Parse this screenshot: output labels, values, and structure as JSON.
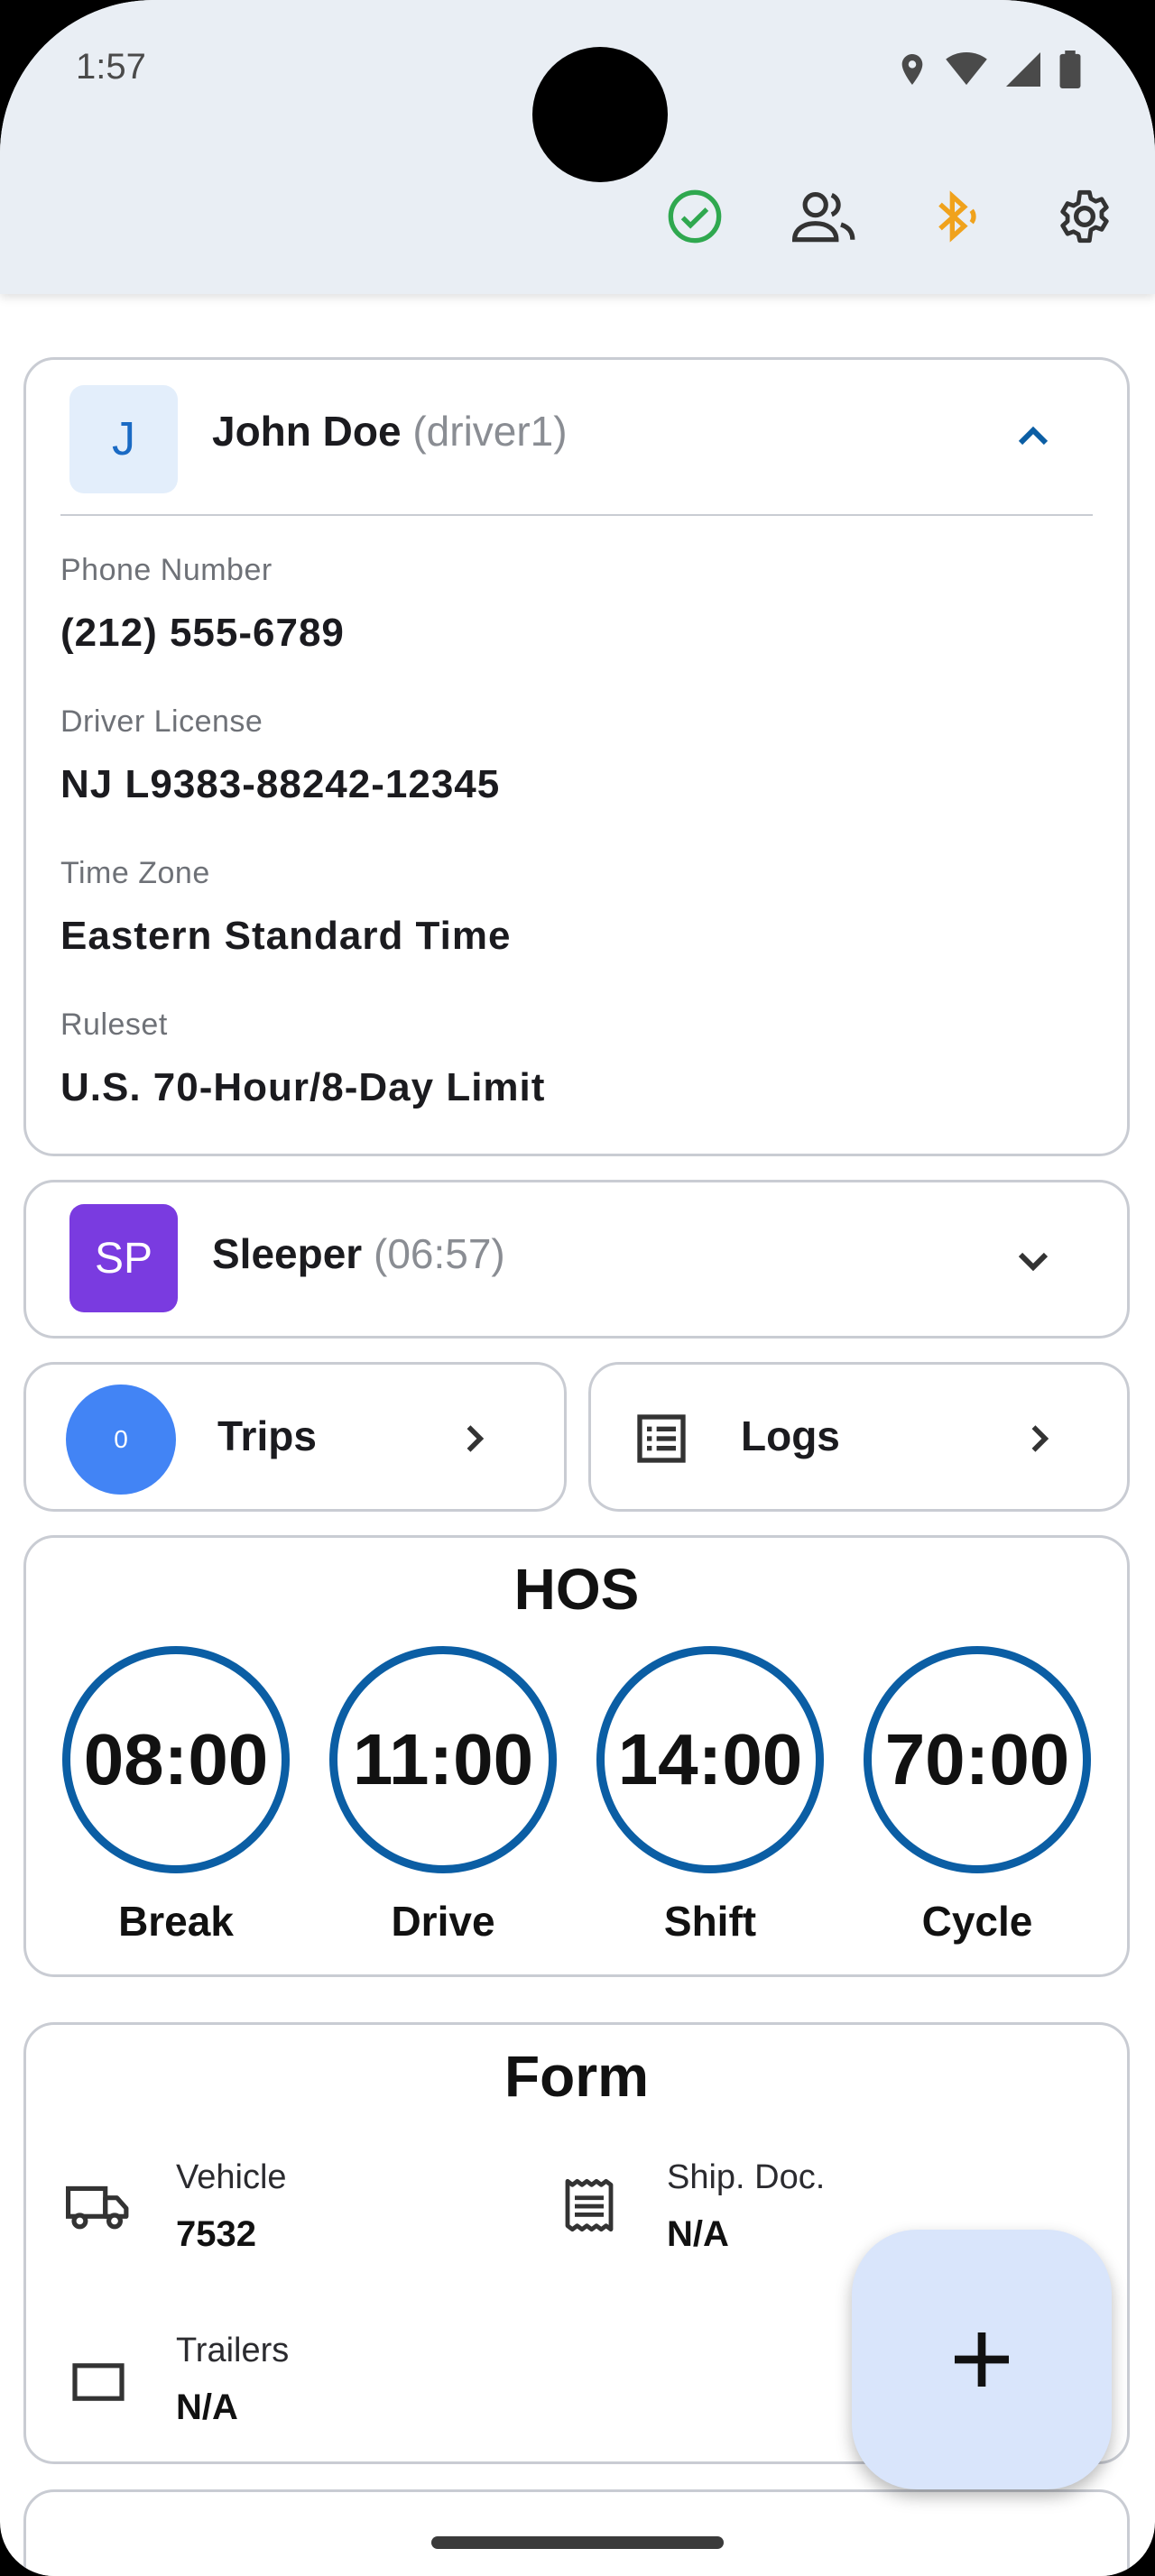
{
  "status_bar": {
    "time": "1:57"
  },
  "header_actions": {
    "sync_icon": "check-circle-icon",
    "drivers_icon": "people-icon",
    "bluetooth_icon": "bluetooth-icon",
    "settings_icon": "gear-icon",
    "colors": {
      "sync": "#2fa84f",
      "bluetooth": "#f0a21c"
    }
  },
  "driver_card": {
    "avatar_letter": "J",
    "name": "John Doe",
    "username": "(driver1)",
    "fields": [
      {
        "label": "Phone Number",
        "value": "(212) 555-6789"
      },
      {
        "label": "Driver License",
        "value": "NJ L9383-88242-12345"
      },
      {
        "label": "Time Zone",
        "value": "Eastern Standard Time"
      },
      {
        "label": "Ruleset",
        "value": "U.S. 70-Hour/8-Day Limit"
      }
    ]
  },
  "status_card": {
    "avatar_text": "SP",
    "status": "Sleeper",
    "duration": "(06:57)",
    "color": "#7a3be0"
  },
  "trips": {
    "count": "0",
    "label": "Trips"
  },
  "logs": {
    "label": "Logs"
  },
  "hos": {
    "title": "HOS",
    "clocks": [
      {
        "value": "08:00",
        "label": "Break"
      },
      {
        "value": "11:00",
        "label": "Drive"
      },
      {
        "value": "14:00",
        "label": "Shift"
      },
      {
        "value": "70:00",
        "label": "Cycle"
      }
    ],
    "ring_color": "#0b5ea4"
  },
  "form": {
    "title": "Form",
    "vehicle": {
      "label": "Vehicle",
      "value": "7532"
    },
    "ship_doc": {
      "label": "Ship. Doc.",
      "value": "N/A"
    },
    "trailers": {
      "label": "Trailers",
      "value": "N/A"
    }
  }
}
